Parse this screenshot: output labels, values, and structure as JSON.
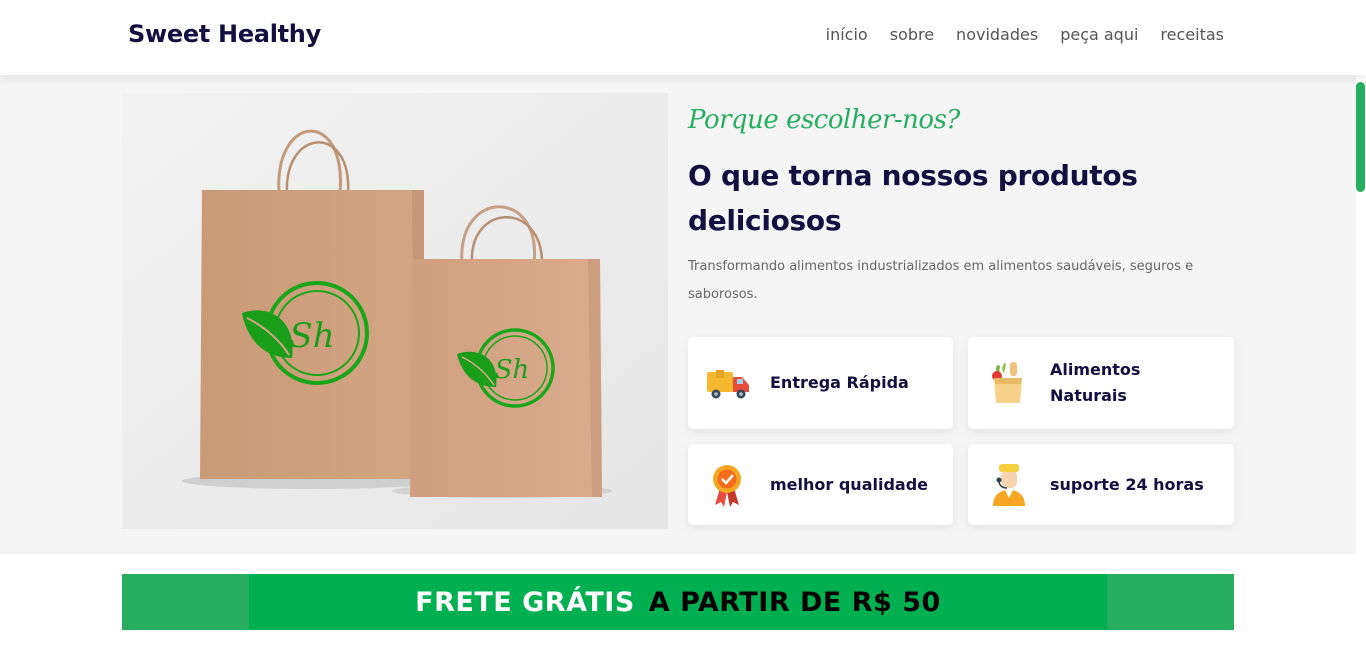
{
  "header": {
    "logo": "Sweet Healthy",
    "nav": [
      "início",
      "sobre",
      "novidades",
      "peça aqui",
      "receitas"
    ]
  },
  "about": {
    "subtitle": "Porque escolher-nos?",
    "title": "O que torna nossos produtos deliciosos",
    "description": "Transformando alimentos industrializados em alimentos saudáveis, seguros e saborosos.",
    "image_logo_text": "Sh",
    "features": [
      {
        "label": "Entrega Rápida",
        "icon": "delivery-truck-icon"
      },
      {
        "label": "Alimentos Naturais",
        "icon": "grocery-bag-icon"
      },
      {
        "label": "melhor qualidade",
        "icon": "quality-medal-icon"
      },
      {
        "label": "suporte 24 horas",
        "icon": "support-agent-icon"
      }
    ]
  },
  "banner": {
    "part1": "FRETE GRÁTIS",
    "part2": "A PARTIR DE R$ 50"
  },
  "colors": {
    "accent": "#27ae60",
    "banner_green": "#00b050",
    "title": "#130f40",
    "logo_green": "#1a9e1a"
  }
}
